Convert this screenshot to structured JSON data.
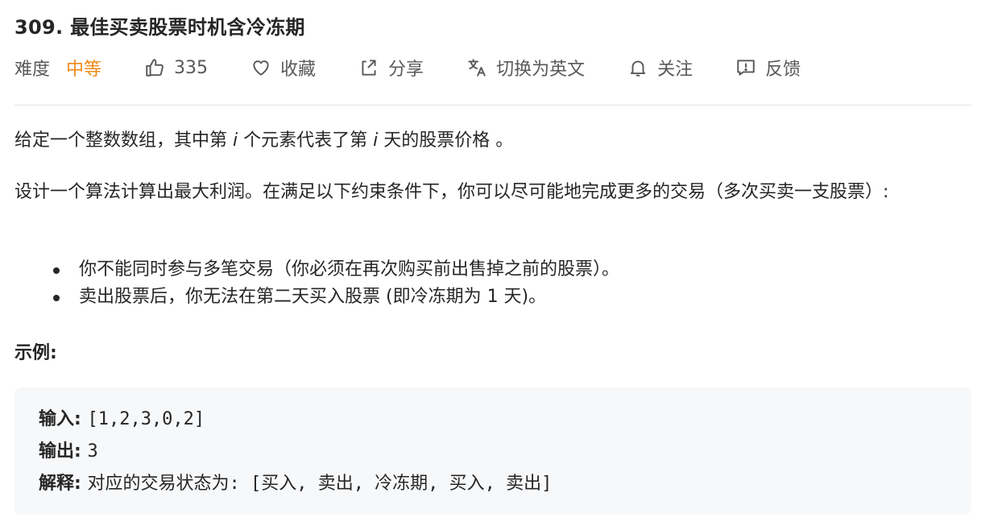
{
  "problem": {
    "title": "309. 最佳买卖股票时机含冷冻期"
  },
  "toolbar": {
    "difficulty_label": "难度",
    "difficulty_value": "中等",
    "like_count": "335",
    "collect_label": "收藏",
    "share_label": "分享",
    "switch_lang_label": "切换为英文",
    "follow_label": "关注",
    "feedback_label": "反馈",
    "difficulty_color": "#ef8a16",
    "icons": [
      "thumbs-up-icon",
      "heart-icon",
      "share-icon",
      "translate-icon",
      "bell-icon",
      "feedback-icon"
    ]
  },
  "description": {
    "p1_a": "给定一个整数数组，其中第 ",
    "p1_i1": "i",
    "p1_b": " 个元素代表了第 ",
    "p1_i2": "i",
    "p1_c": " 天的股票价格 。",
    "p2": "设计一个算法计算出最大利润。在满足以下约束条件下，你可以尽可能地完成更多的交易（多次买卖一支股票）:",
    "bullets": [
      "你不能同时参与多笔交易（你必须在再次购买前出售掉之前的股票）。",
      "卖出股票后，你无法在第二天买入股票 (即冷冻期为 1 天)。"
    ]
  },
  "example": {
    "title": "示例:",
    "input_label": "输入: ",
    "input_value": "[1,2,3,0,2]",
    "output_label": "输出: ",
    "output_value": "3",
    "explain_label": "解释: ",
    "explain_value": "对应的交易状态为: [买入, 卖出, 冷冻期, 买入, 卖出]"
  }
}
